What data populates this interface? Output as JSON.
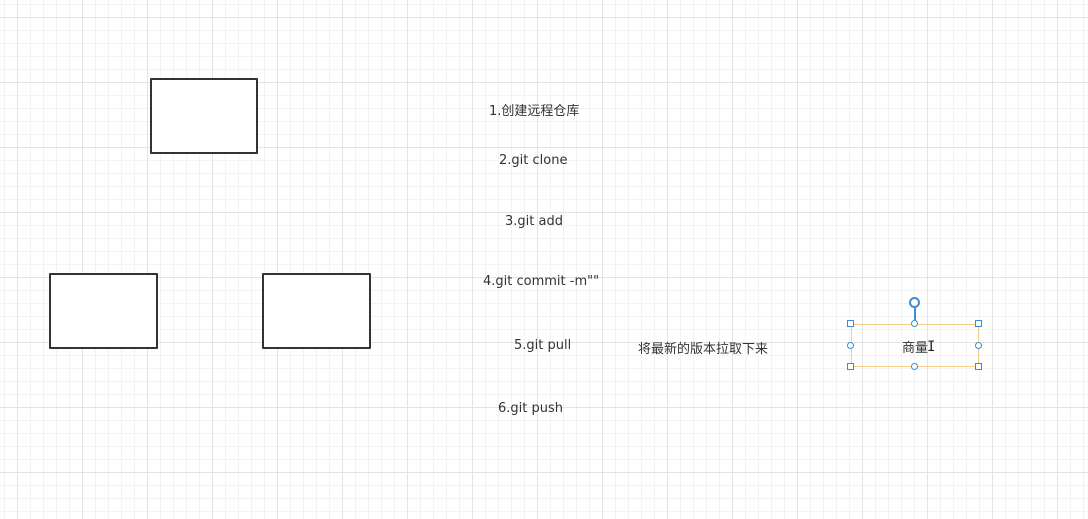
{
  "steps": [
    "1.创建远程仓库",
    "2.git clone",
    "3.git add",
    "4.git commit -m\"\"",
    "5.git pull",
    "6.git push"
  ],
  "pull_note": "将最新的版本拉取下来",
  "selected_text": "商量",
  "colors": {
    "selection_border": "#f5d08a",
    "handle": "#3b8ed6",
    "box_border": "#333333"
  }
}
